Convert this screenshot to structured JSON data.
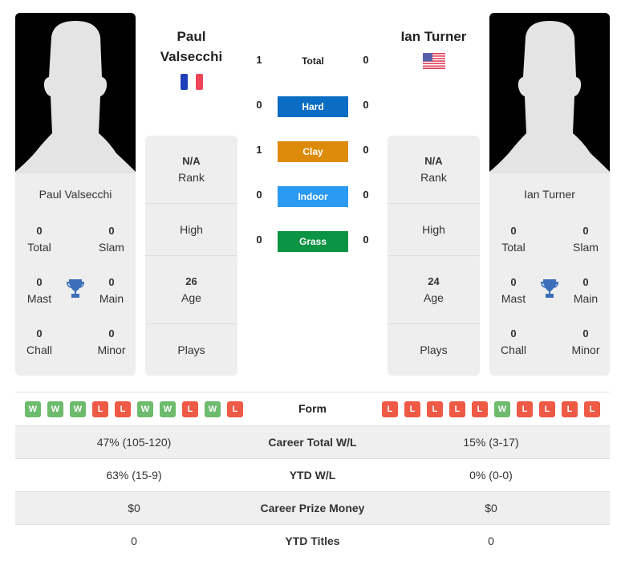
{
  "player1": {
    "name_line1": "Paul",
    "name_line2": "Valsecchi",
    "card_name": "Paul Valsecchi",
    "country_flag": "france-flag",
    "rank_value": "N/A",
    "rank_label": "Rank",
    "high_label": "High",
    "age_value": "26",
    "age_label": "Age",
    "plays_label": "Plays",
    "titles": {
      "total": {
        "value": "0",
        "label": "Total"
      },
      "slam": {
        "value": "0",
        "label": "Slam"
      },
      "mast": {
        "value": "0",
        "label": "Mast"
      },
      "main": {
        "value": "0",
        "label": "Main"
      },
      "chall": {
        "value": "0",
        "label": "Chall"
      },
      "minor": {
        "value": "0",
        "label": "Minor"
      }
    },
    "form": [
      "W",
      "W",
      "W",
      "L",
      "L",
      "W",
      "W",
      "L",
      "W",
      "L"
    ]
  },
  "player2": {
    "name": "Ian Turner",
    "card_name": "Ian Turner",
    "country_flag": "usa-flag",
    "rank_value": "N/A",
    "rank_label": "Rank",
    "high_label": "High",
    "age_value": "24",
    "age_label": "Age",
    "plays_label": "Plays",
    "titles": {
      "total": {
        "value": "0",
        "label": "Total"
      },
      "slam": {
        "value": "0",
        "label": "Slam"
      },
      "mast": {
        "value": "0",
        "label": "Mast"
      },
      "main": {
        "value": "0",
        "label": "Main"
      },
      "chall": {
        "value": "0",
        "label": "Chall"
      },
      "minor": {
        "value": "0",
        "label": "Minor"
      }
    },
    "form": [
      "L",
      "L",
      "L",
      "L",
      "L",
      "W",
      "L",
      "L",
      "L",
      "L"
    ]
  },
  "h2h": {
    "total": {
      "label": "Total",
      "p1": "1",
      "p2": "0"
    },
    "surfaces": [
      {
        "label": "Hard",
        "p1": "0",
        "p2": "0",
        "color": "#0a6cc2"
      },
      {
        "label": "Clay",
        "p1": "1",
        "p2": "0",
        "color": "#de8b0b"
      },
      {
        "label": "Indoor",
        "p1": "0",
        "p2": "0",
        "color": "#2b9af3"
      },
      {
        "label": "Grass",
        "p1": "0",
        "p2": "0",
        "color": "#0b9444"
      }
    ]
  },
  "table": {
    "form_label": "Form",
    "rows": [
      {
        "label": "Career Total W/L",
        "p1": "47% (105-120)",
        "p2": "15% (3-17)"
      },
      {
        "label": "YTD W/L",
        "p1": "63% (15-9)",
        "p2": "0% (0-0)"
      },
      {
        "label": "Career Prize Money",
        "p1": "$0",
        "p2": "$0"
      },
      {
        "label": "YTD Titles",
        "p1": "0",
        "p2": "0"
      }
    ]
  },
  "colors": {
    "win": "#6dbb6d",
    "loss": "#ee5a45",
    "trophy": "#3b6fba"
  }
}
